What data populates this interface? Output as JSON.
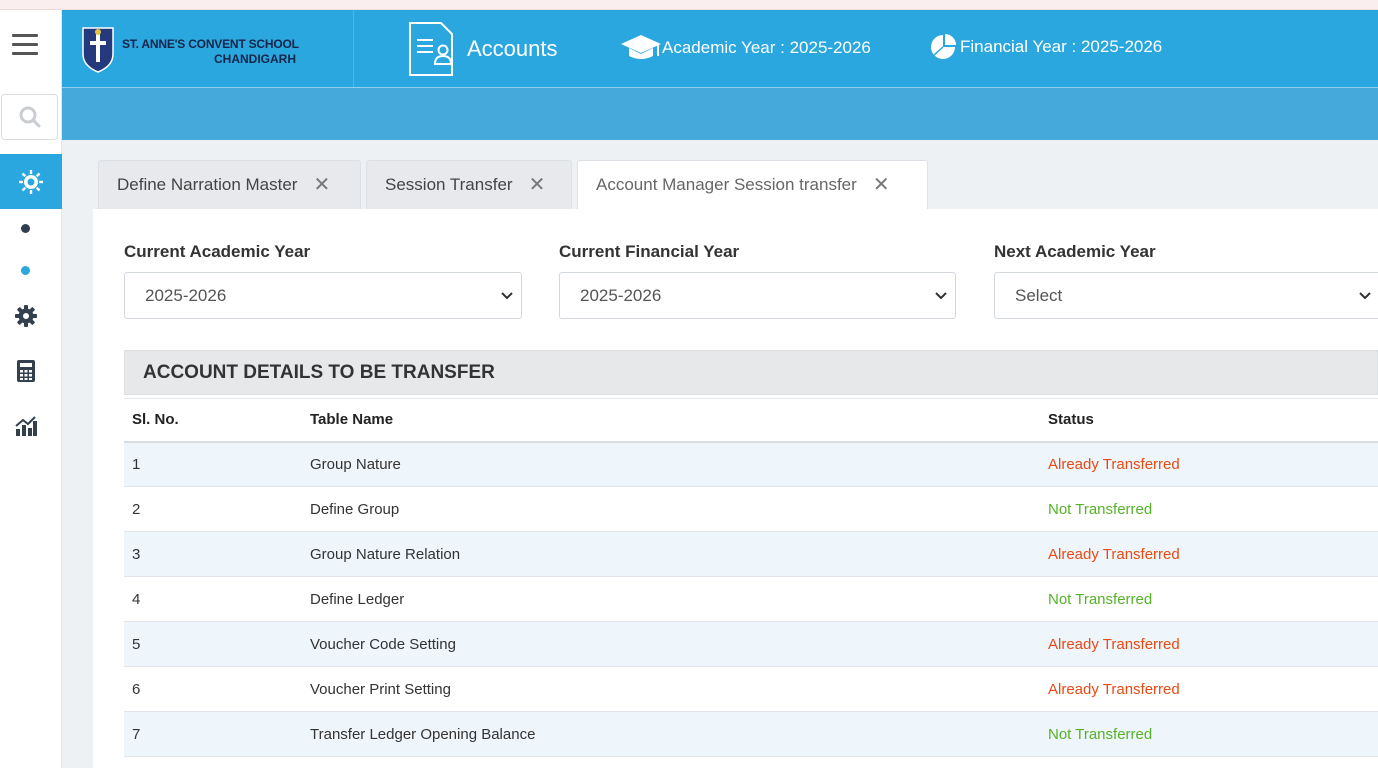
{
  "header": {
    "school_line1": "ST. ANNE'S CONVENT SCHOOL",
    "school_line2": "CHANDIGARH",
    "module_title": "Accounts",
    "academic_year": "Academic Year : 2025-2026",
    "financial_year": "Financial Year : 2025-2026"
  },
  "sidebar": {
    "items": [
      {
        "icon": "hamburger-menu-icon"
      },
      {
        "icon": "search-icon"
      },
      {
        "icon": "sun-gear-icon"
      },
      {
        "icon": "dot-icon"
      },
      {
        "icon": "dot-icon"
      },
      {
        "icon": "gear-icon"
      },
      {
        "icon": "calculator-icon"
      },
      {
        "icon": "chart-icon"
      }
    ]
  },
  "tabs": [
    {
      "label": "Define Narration Master"
    },
    {
      "label": "Session Transfer"
    },
    {
      "label": "Account Manager Session transfer"
    }
  ],
  "filters": {
    "current_academic_year": {
      "label": "Current Academic Year",
      "value": "2025-2026"
    },
    "current_financial_year": {
      "label": "Current Financial Year",
      "value": "2025-2026"
    },
    "next_academic_year": {
      "label": "Next Academic Year",
      "value": "Select"
    }
  },
  "section_title": "ACCOUNT DETAILS TO BE TRANSFER",
  "table": {
    "columns": [
      "Sl. No.",
      "Table Name",
      "Status"
    ],
    "rows": [
      {
        "sl": "1",
        "name": "Group Nature",
        "status": "Already Transferred"
      },
      {
        "sl": "2",
        "name": "Define Group",
        "status": "Not Transferred"
      },
      {
        "sl": "3",
        "name": "Group Nature Relation",
        "status": "Already Transferred"
      },
      {
        "sl": "4",
        "name": "Define Ledger",
        "status": "Not Transferred"
      },
      {
        "sl": "5",
        "name": "Voucher Code Setting",
        "status": "Already Transferred"
      },
      {
        "sl": "6",
        "name": "Voucher Print Setting",
        "status": "Already Transferred"
      },
      {
        "sl": "7",
        "name": "Transfer Ledger Opening Balance",
        "status": "Not Transferred"
      }
    ]
  },
  "colors": {
    "header_blue": "#2aa7df",
    "already": "#ea4a14",
    "not": "#56b229"
  }
}
